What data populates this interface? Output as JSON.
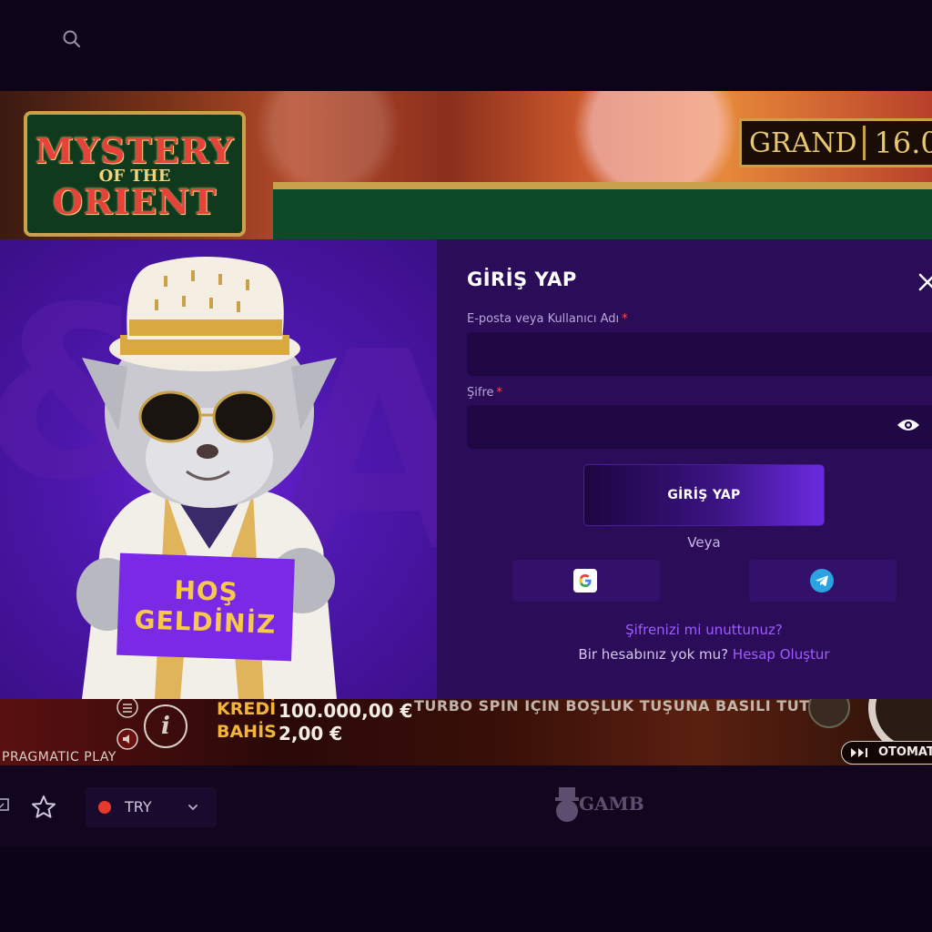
{
  "game": {
    "logo": {
      "line1": "MYSTERY",
      "line2": "OF THE",
      "line3": "ORIENT"
    },
    "grand": {
      "label": "GRAND",
      "value": "16.0"
    },
    "controls": {
      "credit_label": "KREDİ",
      "credit_value": "100.000,00 €",
      "bet_label": "BAHİS",
      "bet_value": "2,00 €",
      "provider": "PRAGMATIC PLAY",
      "turbo_hint": "TURBO SPİN İÇİN BOŞLUK TUŞUNA BASILI TUTUN",
      "autoplay_label": "OTOMAT"
    }
  },
  "welcome": {
    "line1": "HOŞ",
    "line2": "GELDİNİZ"
  },
  "login": {
    "title": "GİRİŞ YAP",
    "username_label": "E-posta veya Kullanıcı Adı",
    "password_label": "Şifre",
    "required_mark": "*",
    "submit_label": "GİRİŞ YAP",
    "or_text": "Veya",
    "forgot_link": "Şifrenizi mi unuttunuz?",
    "no_account_text": "Bir hesabınız yok mu?",
    "register_link": "Hesap Oluştur"
  },
  "bottom": {
    "currency": "TRY",
    "site_logo": "GAMB"
  },
  "colors": {
    "accent": "#9f5cff",
    "modal_bg": "#2a0c58",
    "input_bg": "#1f0843",
    "welcome_text": "#f7c948",
    "required": "#ff4b4b"
  },
  "icons": {
    "search": "search-icon",
    "close": "close-icon",
    "eye": "eye-icon",
    "google": "google-icon",
    "telegram": "telegram-icon",
    "star": "star-icon",
    "chevron": "chevron-down-icon"
  }
}
